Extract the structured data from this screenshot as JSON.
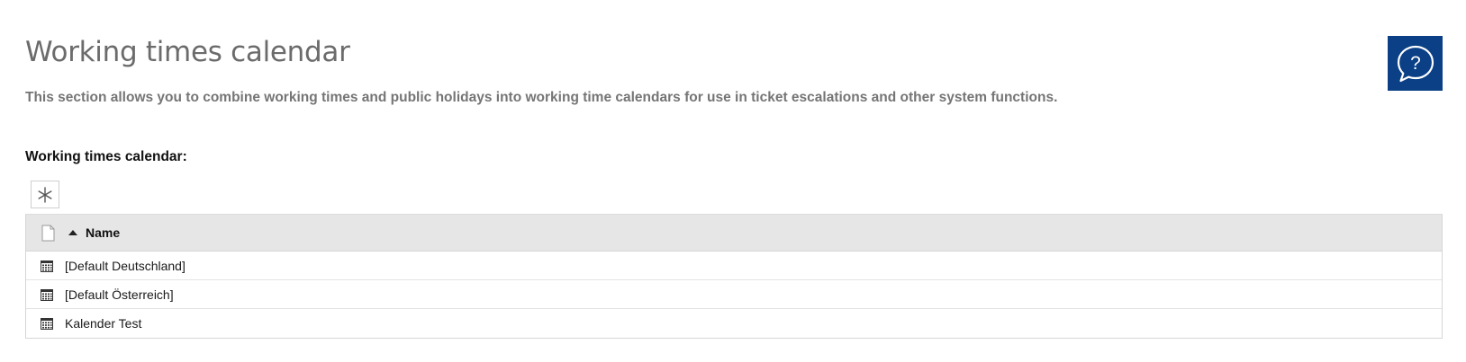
{
  "page": {
    "title": "Working times calendar",
    "description": "This section allows you to combine working times and public holidays into working time calendars for use in ticket escalations and other system functions."
  },
  "help": {
    "icon": "help-chat-icon",
    "color": "#0b3f86"
  },
  "section": {
    "label": "Working times calendar:"
  },
  "toolbar": {
    "add_icon": "asterisk-icon"
  },
  "grid": {
    "header": {
      "name_column": "Name",
      "sort": "ascending"
    },
    "rows": [
      {
        "name": "[Default Deutschland]"
      },
      {
        "name": "[Default Österreich]"
      },
      {
        "name": "Kalender Test"
      }
    ]
  }
}
